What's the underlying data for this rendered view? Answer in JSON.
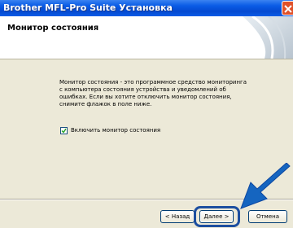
{
  "window": {
    "title": "Brother MFL-Pro Suite Установка"
  },
  "header": {
    "title": "Монитор состояния"
  },
  "content": {
    "description_lines": [
      "Монитор состояния - это программное средство мониторинга",
      "с компьютера состояния устройства и уведомлений об",
      "ошибках. Если вы хотите отключить монитор состояния,",
      "снимите флажок в поле ниже."
    ],
    "checkbox": {
      "label": "Включить монитор состояния",
      "checked": true
    }
  },
  "buttons": {
    "back": "< Назад",
    "next": "Далее >",
    "cancel": "Отмена"
  },
  "colors": {
    "titlebar": "#0a5ce6",
    "highlight": "#1d4fa0",
    "arrow": "#1565c0"
  }
}
